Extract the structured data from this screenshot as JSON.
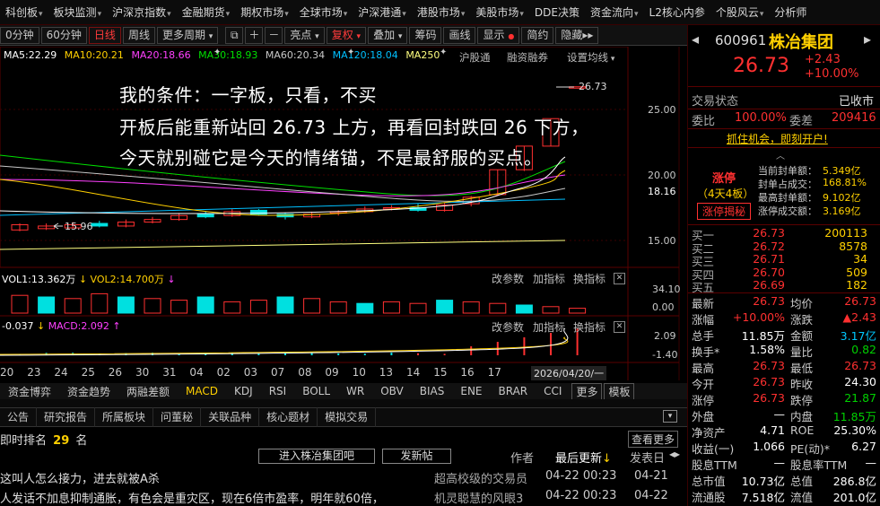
{
  "top_menu": [
    {
      "label": "科创板",
      "arrow": true
    },
    {
      "label": "板块监测",
      "arrow": true
    },
    {
      "label": "沪深京指数",
      "arrow": true
    },
    {
      "label": "金融期货",
      "arrow": true
    },
    {
      "label": "期权市场",
      "arrow": true
    },
    {
      "label": "全球市场",
      "arrow": true
    },
    {
      "label": "沪深港通",
      "arrow": true
    },
    {
      "label": "港股市场",
      "arrow": true
    },
    {
      "label": "美股市场",
      "arrow": true
    },
    {
      "label": "DDE决策",
      "arrow": false
    },
    {
      "label": "资金流向",
      "arrow": true
    },
    {
      "label": "L2核心内参",
      "arrow": false
    },
    {
      "label": "个股风云",
      "arrow": true
    },
    {
      "label": "分析师",
      "arrow": false
    }
  ],
  "toolbar": {
    "p30": "0分钟",
    "p60": "60分钟",
    "day": "日线",
    "week": "周线",
    "more_period": "更多周期",
    "highlight": "亮点",
    "fq": "复权",
    "overlay": "叠加",
    "chips": "筹码",
    "draw": "画线",
    "display": "显示",
    "simple": "简约",
    "hide": "隐藏"
  },
  "ma": {
    "ma5": "MA5:22.29",
    "ma10": "MA10:20.21",
    "ma20": "MA20:18.66",
    "ma30": "MA30:18.93",
    "ma60": "MA60:20.34",
    "ma120": "MA120:18.04",
    "ma250": "MA250"
  },
  "chart_links": {
    "hgt": "沪股通",
    "rzrq": "融资融券",
    "set_ma": "设置均线"
  },
  "price_marks": {
    "high": "26.73",
    "low": "15.96"
  },
  "y_axis": {
    "p25": "25.00",
    "p20": "20.00",
    "p1816": "18.16",
    "p15": "15.00"
  },
  "overlay_text": [
    "我的条件：一字板，只看，不买",
    "开板后能重新站回 26.73 上方，再看回封跌回 26 下方，",
    "今天就别碰它是今天的情绪锚，不是最舒服的买点。"
  ],
  "vol_panel": {
    "vol1": "VOL1:13.362万",
    "vol2": "VOL2:14.700万",
    "y1": "34.10",
    "y2": "0.00",
    "btn_param": "改参数",
    "btn_add": "加指标",
    "btn_switch": "换指标"
  },
  "macd_panel": {
    "diff": "-0.037",
    "macd": "MACD:2.092",
    "y1": "2.09",
    "y2": "-1.40",
    "btn_param": "改参数",
    "btn_add": "加指标",
    "btn_switch": "换指标"
  },
  "dates": [
    "20",
    "23",
    "24",
    "25",
    "26",
    "30",
    "31",
    "04",
    "02",
    "03",
    "07",
    "08",
    "09",
    "10",
    "13",
    "14",
    "15",
    "16",
    "17"
  ],
  "date_cursor": "2026/04/20/一",
  "indicator_tabs": [
    "资金博弈",
    "资金趋势",
    "两融差额",
    "MACD",
    "KDJ",
    "RSI",
    "BOLL",
    "WR",
    "OBV",
    "BIAS",
    "ENE",
    "BRAR",
    "CCI",
    "更多",
    "模板"
  ],
  "bottom_tabs": [
    "公告",
    "研究报告",
    "所属板块",
    "问董秘",
    "关联品种",
    "核心题材",
    "模拟交易"
  ],
  "forum": {
    "rank_label": "即时排名",
    "rank": "29",
    "rank_unit": "名",
    "enter_btn": "进入株冶集团吧",
    "post_btn": "发新帖",
    "view_more": "查看更多",
    "col_author": "作者",
    "col_latest": "最后更新",
    "col_posted": "发表日",
    "posts": [
      {
        "title": "这叫人怎么接力，进去就被A杀",
        "author": "超高校级的交易员",
        "updated": "04-22 00:23",
        "posted": "04-21"
      },
      {
        "title": "人发话不加息抑制通胀，有色会是重灾区，现在6倍市盈率，明年就60倍，",
        "author": "机灵聪慧的风眼3",
        "updated": "04-22 00:23",
        "posted": "04-22"
      }
    ]
  },
  "quote": {
    "code": "600961",
    "name": "株冶集团",
    "price": "26.73",
    "change": "+2.43",
    "pct": "+10.00%",
    "status_label": "交易状态",
    "status": "已收市",
    "wb_label": "委比",
    "wb": "100.00%",
    "wc_label": "委差",
    "wc": "209416",
    "promo": "抓住机会，即刻开户!",
    "limit_label": "涨停",
    "limit_sub": "（4天4板）",
    "limit_btn": "涨停揭秘",
    "limit_stats": [
      {
        "k": "当前封单额：",
        "v": "5.349亿"
      },
      {
        "k": "封单占成交：",
        "v": "168.81%"
      },
      {
        "k": "最高封单额：",
        "v": "9.102亿"
      },
      {
        "k": "涨停成交额：",
        "v": "3.169亿"
      }
    ],
    "bids": [
      {
        "label": "买一",
        "price": "26.73",
        "vol": "200113"
      },
      {
        "label": "买二",
        "price": "26.72",
        "vol": "8578"
      },
      {
        "label": "买三",
        "price": "26.71",
        "vol": "34"
      },
      {
        "label": "买四",
        "price": "26.70",
        "vol": "509"
      },
      {
        "label": "买五",
        "price": "26.69",
        "vol": "182"
      }
    ],
    "stats": [
      {
        "k1": "最新",
        "v1": "26.73",
        "c1": "red",
        "k2": "均价",
        "v2": "26.73",
        "c2": "red"
      },
      {
        "k1": "涨幅",
        "v1": "+10.00%",
        "c1": "red",
        "k2": "涨跌",
        "v2": "▲2.43",
        "c2": "red"
      },
      {
        "k1": "总手",
        "v1": "11.85万",
        "c1": "wht",
        "k2": "金额",
        "v2": "3.17亿",
        "c2": "cy"
      },
      {
        "k1": "换手*",
        "v1": "1.58%",
        "c1": "wht",
        "k2": "量比",
        "v2": "0.82",
        "c2": "grn"
      },
      {
        "k1": "最高",
        "v1": "26.73",
        "c1": "red",
        "k2": "最低",
        "v2": "26.73",
        "c2": "red"
      },
      {
        "k1": "今开",
        "v1": "26.73",
        "c1": "red",
        "k2": "昨收",
        "v2": "24.30",
        "c2": "wht"
      },
      {
        "k1": "涨停",
        "v1": "26.73",
        "c1": "red",
        "k2": "跌停",
        "v2": "21.87",
        "c2": "grn"
      },
      {
        "k1": "外盘",
        "v1": "—",
        "c1": "wht",
        "k2": "内盘",
        "v2": "11.85万",
        "c2": "grn"
      },
      {
        "k1": "净资产",
        "v1": "4.71",
        "c1": "wht",
        "k2": "ROE",
        "v2": "25.30%",
        "c2": "wht"
      },
      {
        "k1": "收益(一)",
        "v1": "1.066",
        "c1": "wht",
        "k2": "PE(动)*",
        "v2": "6.27",
        "c2": "wht"
      },
      {
        "k1": "股息TTM",
        "v1": "—",
        "c1": "wht",
        "k2": "股息率TTM",
        "v2": "—",
        "c2": "wht"
      },
      {
        "k1": "总市值",
        "v1": "10.73亿",
        "c1": "wht",
        "k2": "总值",
        "v2": "286.8亿",
        "c2": "wht"
      },
      {
        "k1": "流通股",
        "v1": "7.518亿",
        "c1": "wht",
        "k2": "流值",
        "v2": "201.0亿",
        "c2": "wht"
      }
    ]
  },
  "colors": {
    "up": "#ff3030",
    "down": "#00e0e0",
    "bg": "#000000"
  }
}
